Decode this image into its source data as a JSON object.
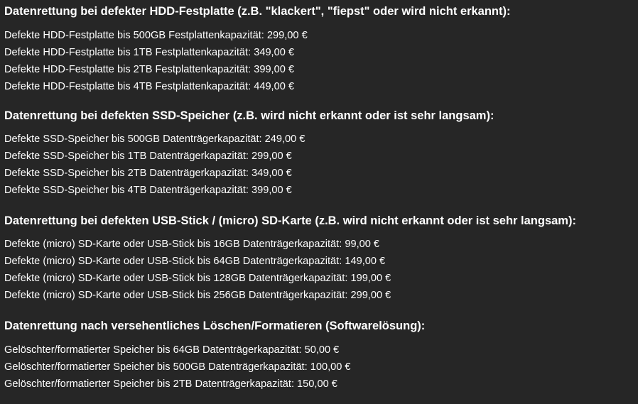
{
  "sections": [
    {
      "heading": "Datenrettung bei defekter HDD-Festplatte (z.B. \"klackert\", \"fiepst\" oder wird nicht erkannt):",
      "items": [
        "Defekte HDD-Festplatte bis 500GB Festplattenkapazität: 299,00 €",
        "Defekte HDD-Festplatte bis 1TB Festplattenkapazität: 349,00 €",
        "Defekte HDD-Festplatte bis 2TB Festplattenkapazität: 399,00 €",
        "Defekte HDD-Festplatte bis 4TB Festplattenkapazität: 449,00 €"
      ]
    },
    {
      "heading": "Datenrettung bei defekten SSD-Speicher (z.B. wird nicht erkannt oder ist sehr langsam):",
      "items": [
        "Defekte SSD-Speicher bis 500GB Datenträgerkapazität: 249,00 €",
        "Defekte SSD-Speicher bis 1TB Datenträgerkapazität: 299,00 €",
        "Defekte SSD-Speicher bis 2TB Datenträgerkapazität: 349,00 €",
        "Defekte SSD-Speicher bis 4TB Datenträgerkapazität: 399,00 €"
      ]
    },
    {
      "heading": "Datenrettung bei defekten USB-Stick / (micro) SD-Karte (z.B. wird nicht erkannt oder ist sehr langsam):",
      "items": [
        "Defekte (micro) SD-Karte oder USB-Stick bis 16GB Datenträgerkapazität: 99,00 €",
        "Defekte (micro) SD-Karte oder USB-Stick bis 64GB Datenträgerkapazität: 149,00 €",
        "Defekte (micro) SD-Karte oder USB-Stick bis 128GB Datenträgerkapazität: 199,00 €",
        "Defekte (micro) SD-Karte oder USB-Stick bis 256GB Datenträgerkapazität: 299,00 €"
      ]
    },
    {
      "heading": "Datenrettung nach versehentliches Löschen/Formatieren (Softwarelösung):",
      "items": [
        "Gelöschter/formatierter Speicher bis 64GB Datenträgerkapazität: 50,00 €",
        "Gelöschter/formatierter Speicher bis 500GB Datenträgerkapazität: 100,00 €",
        "Gelöschter/formatierter Speicher bis 2TB Datenträgerkapazität: 150,00 €"
      ]
    }
  ]
}
